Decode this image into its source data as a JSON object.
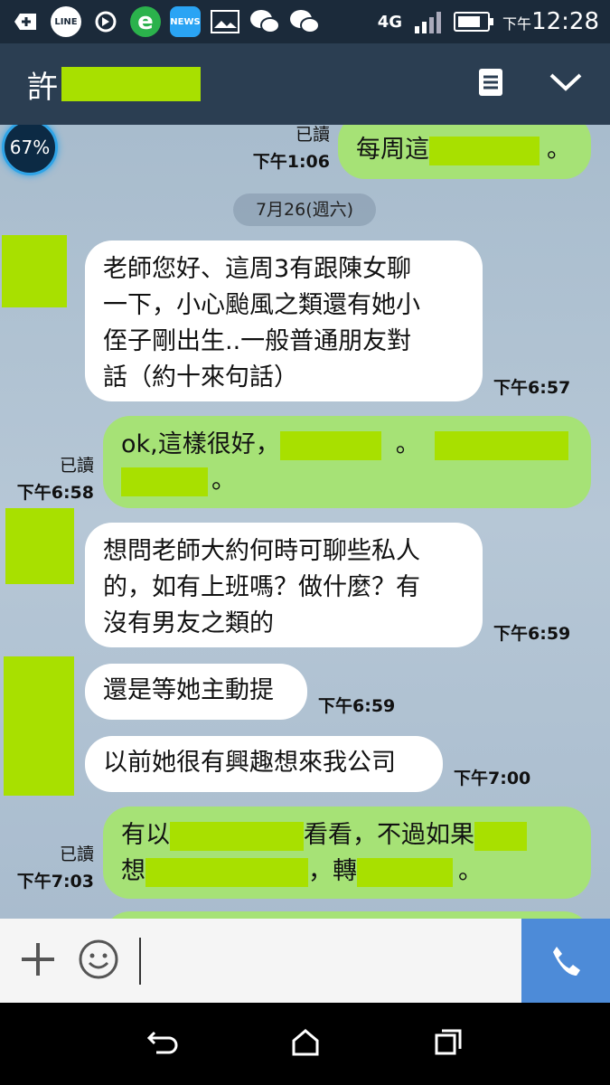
{
  "status_bar": {
    "icons": [
      "plus-icon",
      "line-icon",
      "sync-icon",
      "ie-icon",
      "news-icon",
      "image-icon",
      "wechat-icon",
      "wechat-icon"
    ],
    "news_label": "NEWS",
    "line_label": "LINE",
    "network": "4G",
    "time_prefix": "下午",
    "time": "12:28"
  },
  "header": {
    "title": "許"
  },
  "battery_widget": "67%",
  "date_separator": "7月26(週六)",
  "messages": [
    {
      "side": "mine",
      "text_a": "每周這",
      "text_b": "。",
      "read": "已讀",
      "time": "下午1:06"
    },
    {
      "side": "theirs",
      "lines": [
        "老師您好、這周3有跟陳女聊",
        "一下，小心颱風之類還有她小",
        "侄子剛出生..一般普通朋友對",
        "話（約十來句話）"
      ],
      "time": "下午6:57"
    },
    {
      "side": "mine",
      "text_a": "ok,這樣很好，",
      "text_b": "。",
      "text_c": "。",
      "read": "已讀",
      "time": "下午6:58"
    },
    {
      "side": "theirs",
      "lines": [
        "想問老師大約何時可聊些私人",
        "的，如有上班嗎？做什麼？有",
        "沒有男友之類的"
      ],
      "time": "下午6:59"
    },
    {
      "side": "theirs",
      "lines": [
        "還是等她主動提"
      ],
      "time": "下午6:59"
    },
    {
      "side": "theirs",
      "lines": [
        "以前她很有興趣想來我公司"
      ],
      "time": "下午7:00"
    },
    {
      "side": "mine",
      "text_a": "有以",
      "text_b": "看看，不過如果",
      "text_c": "想",
      "text_d": "，轉",
      "text_e": "。",
      "read": "已讀",
      "time": "下午7:03"
    }
  ],
  "colors": {
    "mine_bubble": "#a6e276",
    "theirs_bubble": "#ffffff",
    "redaction": "#a8e000",
    "send_button": "#4d8bd8"
  }
}
